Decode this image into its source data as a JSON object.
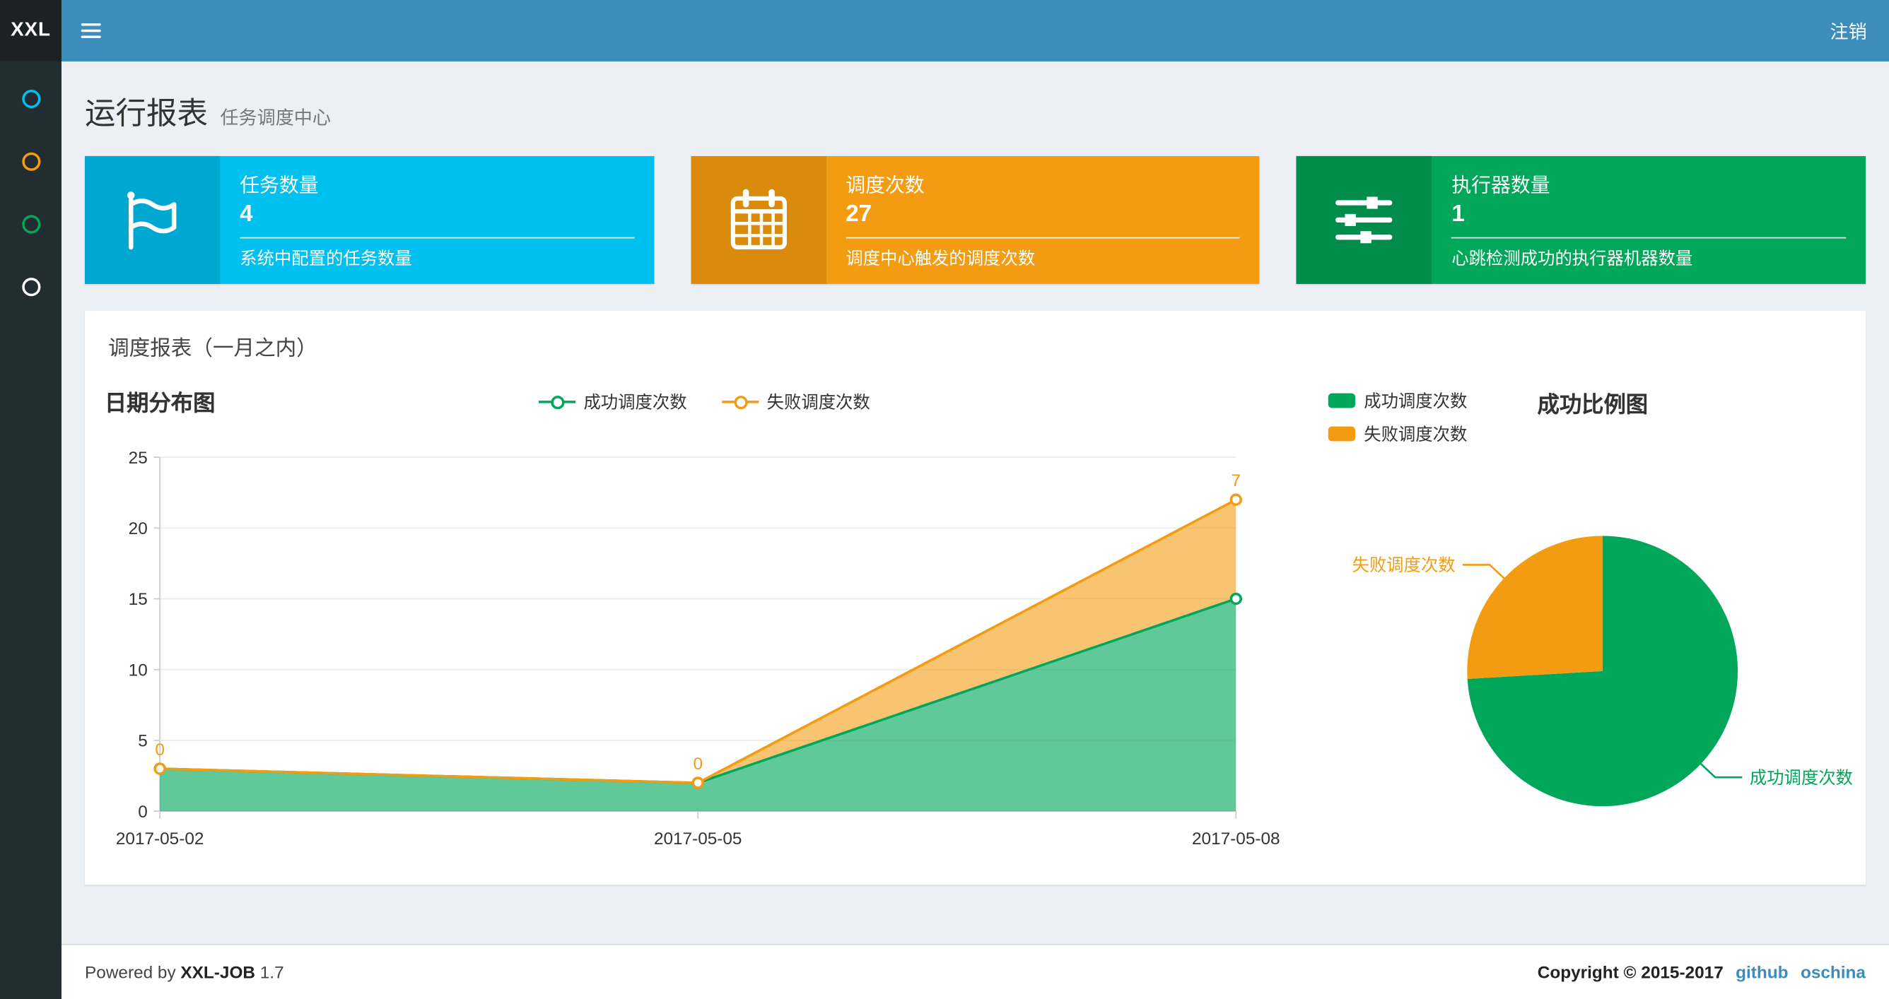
{
  "navbar": {
    "logo": "XXL",
    "logout_label": "注销"
  },
  "sidebar": {
    "items": [
      {
        "icon": "circle-outline-icon",
        "color": "#00c0ef"
      },
      {
        "icon": "circle-outline-icon",
        "color": "#f39c12"
      },
      {
        "icon": "circle-outline-icon",
        "color": "#00a65a"
      },
      {
        "icon": "circle-outline-icon",
        "color": "#ffffff"
      }
    ]
  },
  "page_header": {
    "title": "运行报表",
    "subtitle": "任务调度中心"
  },
  "info_boxes": [
    {
      "icon": "flag-icon",
      "title": "任务数量",
      "value": "4",
      "desc": "系统中配置的任务数量",
      "bg": "#00c0ef",
      "icon_bg": "#00a7d0"
    },
    {
      "icon": "calendar-icon",
      "title": "调度次数",
      "value": "27",
      "desc": "调度中心触发的调度次数",
      "bg": "#f39c12",
      "icon_bg": "#db8b0b"
    },
    {
      "icon": "sliders-icon",
      "title": "执行器数量",
      "value": "1",
      "desc": "心跳检测成功的执行器机器数量",
      "bg": "#00a65a",
      "icon_bg": "#008d4c"
    }
  ],
  "panel": {
    "title": "调度报表（一月之内）"
  },
  "chart_data": [
    {
      "type": "area",
      "title": "日期分布图",
      "stacked": true,
      "x": [
        "2017-05-02",
        "2017-05-05",
        "2017-05-08"
      ],
      "series": [
        {
          "name": "成功调度次数",
          "values": [
            3,
            2,
            15
          ],
          "color": "#00a65a"
        },
        {
          "name": "失败调度次数",
          "values": [
            0,
            0,
            7
          ],
          "color": "#f39c12"
        }
      ],
      "point_labels": [
        "0",
        "0",
        "7"
      ],
      "ylim": [
        0,
        25
      ],
      "yticks": [
        0,
        5,
        10,
        15,
        20,
        25
      ],
      "grid": true,
      "legend_position": "top-center"
    },
    {
      "type": "pie",
      "title": "成功比例图",
      "slices": [
        {
          "name": "成功调度次数",
          "value": 20,
          "color": "#00a65a"
        },
        {
          "name": "失败调度次数",
          "value": 7,
          "color": "#f39c12"
        }
      ],
      "legend_position": "top-left"
    }
  ],
  "footer": {
    "powered_by": "Powered by",
    "product": "XXL-JOB",
    "version": "1.7",
    "copyright": "Copyright © 2015-2017",
    "links": [
      "github",
      "oschina"
    ]
  }
}
